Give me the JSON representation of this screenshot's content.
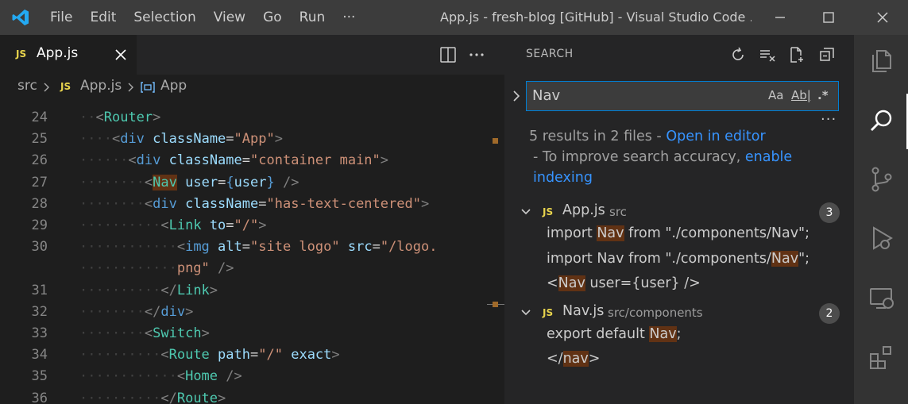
{
  "titlebar": {
    "menu": [
      "File",
      "Edit",
      "Selection",
      "View",
      "Go",
      "Run",
      "···"
    ],
    "title": "App.js - fresh-blog [GitHub] - Visual Studio Code ..."
  },
  "editor": {
    "tab_label": "App.js",
    "file_badge": "JS",
    "breadcrumb": {
      "folder": "src",
      "file": "App.js",
      "symbol": "App"
    },
    "lines": [
      {
        "num": "24",
        "indent": 1,
        "tokens": [
          [
            "t-br",
            "<"
          ],
          [
            "t-tag",
            "Router"
          ],
          [
            "t-br",
            ">"
          ]
        ]
      },
      {
        "num": "25",
        "indent": 2,
        "tokens": [
          [
            "t-br",
            "<"
          ],
          [
            "t-html",
            "div"
          ],
          [
            "t-punc",
            " "
          ],
          [
            "t-attr",
            "className"
          ],
          [
            "t-punc",
            "="
          ],
          [
            "t-str",
            "\"App\""
          ],
          [
            "t-br",
            ">"
          ]
        ]
      },
      {
        "num": "26",
        "indent": 3,
        "tokens": [
          [
            "t-br",
            "<"
          ],
          [
            "t-html",
            "div"
          ],
          [
            "t-punc",
            " "
          ],
          [
            "t-attr",
            "className"
          ],
          [
            "t-punc",
            "="
          ],
          [
            "t-str",
            "\"container main\""
          ],
          [
            "t-br",
            ">"
          ]
        ]
      },
      {
        "num": "27",
        "indent": 4,
        "tokens": [
          [
            "t-br",
            "<"
          ],
          [
            "t-tag hl",
            "Nav"
          ],
          [
            "t-punc",
            " "
          ],
          [
            "t-attr",
            "user"
          ],
          [
            "t-punc",
            "="
          ],
          [
            "t-html",
            "{"
          ],
          [
            "t-attr",
            "user"
          ],
          [
            "t-html",
            "}"
          ],
          [
            "t-punc",
            " "
          ],
          [
            "t-br",
            "/>"
          ]
        ]
      },
      {
        "num": "28",
        "indent": 4,
        "tokens": [
          [
            "t-br",
            "<"
          ],
          [
            "t-html",
            "div"
          ],
          [
            "t-punc",
            " "
          ],
          [
            "t-attr",
            "className"
          ],
          [
            "t-punc",
            "="
          ],
          [
            "t-str",
            "\"has-text-centered\""
          ],
          [
            "t-br",
            ">"
          ]
        ]
      },
      {
        "num": "29",
        "indent": 5,
        "tokens": [
          [
            "t-br",
            "<"
          ],
          [
            "t-tag",
            "Link"
          ],
          [
            "t-punc",
            " "
          ],
          [
            "t-attr",
            "to"
          ],
          [
            "t-punc",
            "="
          ],
          [
            "t-str",
            "\"/\""
          ],
          [
            "t-br",
            ">"
          ]
        ]
      },
      {
        "num": "30",
        "indent": 6,
        "tokens": [
          [
            "t-br",
            "<"
          ],
          [
            "t-html",
            "img"
          ],
          [
            "t-punc",
            " "
          ],
          [
            "t-attr",
            "alt"
          ],
          [
            "t-punc",
            "="
          ],
          [
            "t-str",
            "\"site logo\""
          ],
          [
            "t-punc",
            " "
          ],
          [
            "t-attr",
            "src"
          ],
          [
            "t-punc",
            "="
          ],
          [
            "t-str",
            "\"/logo."
          ]
        ]
      },
      {
        "num": "",
        "indent": 6,
        "tokens": [
          [
            "t-str",
            "png\""
          ],
          [
            "t-punc",
            " "
          ],
          [
            "t-br",
            "/>"
          ]
        ]
      },
      {
        "num": "31",
        "indent": 5,
        "tokens": [
          [
            "t-br",
            "</"
          ],
          [
            "t-tag",
            "Link"
          ],
          [
            "t-br",
            ">"
          ]
        ]
      },
      {
        "num": "32",
        "indent": 4,
        "tokens": [
          [
            "t-br",
            "</"
          ],
          [
            "t-html",
            "div"
          ],
          [
            "t-br",
            ">"
          ]
        ]
      },
      {
        "num": "33",
        "indent": 4,
        "tokens": [
          [
            "t-br",
            "<"
          ],
          [
            "t-tag",
            "Switch"
          ],
          [
            "t-br",
            ">"
          ]
        ]
      },
      {
        "num": "34",
        "indent": 5,
        "tokens": [
          [
            "t-br",
            "<"
          ],
          [
            "t-tag",
            "Route"
          ],
          [
            "t-punc",
            " "
          ],
          [
            "t-attr",
            "path"
          ],
          [
            "t-punc",
            "="
          ],
          [
            "t-str",
            "\"/\""
          ],
          [
            "t-punc",
            " "
          ],
          [
            "t-attr",
            "exact"
          ],
          [
            "t-br",
            ">"
          ]
        ]
      },
      {
        "num": "35",
        "indent": 6,
        "tokens": [
          [
            "t-br",
            "<"
          ],
          [
            "t-tag",
            "Home"
          ],
          [
            "t-punc",
            " "
          ],
          [
            "t-br",
            "/>"
          ]
        ]
      },
      {
        "num": "36",
        "indent": 5,
        "tokens": [
          [
            "t-br",
            "</"
          ],
          [
            "t-tag",
            "Route"
          ],
          [
            "t-br",
            ">"
          ]
        ]
      }
    ]
  },
  "search": {
    "title": "SEARCH",
    "query": "Nav",
    "opt_case": "Aa",
    "opt_word": "Ab|",
    "opt_regex": ".*",
    "summary": "5 results in 2 files - ",
    "open_in_editor": "Open in editor",
    "hint": "- To improve search accuracy, ",
    "enable": "enable",
    "indexing": "indexing",
    "files": [
      {
        "name": "App.js",
        "path": "src",
        "count": "3",
        "matches": [
          {
            "before": "import ",
            "hit": "Nav",
            "after": " from \"./components/Nav\";"
          },
          {
            "before": "import Nav from \"./components/",
            "hit": "Nav",
            "after": "\";"
          },
          {
            "before": "<",
            "hit": "Nav",
            "after": " user={user} />"
          }
        ]
      },
      {
        "name": "Nav.js",
        "path": "src/components",
        "count": "2",
        "matches": [
          {
            "before": "export default ",
            "hit": "Nav",
            "after": ";"
          },
          {
            "before": "</",
            "hit": "nav",
            "after": ">"
          }
        ]
      }
    ]
  },
  "icons": {
    "activity": [
      "explorer-icon",
      "search-icon",
      "source-control-icon",
      "run-debug-icon",
      "remote-explorer-icon",
      "extensions-icon"
    ]
  }
}
